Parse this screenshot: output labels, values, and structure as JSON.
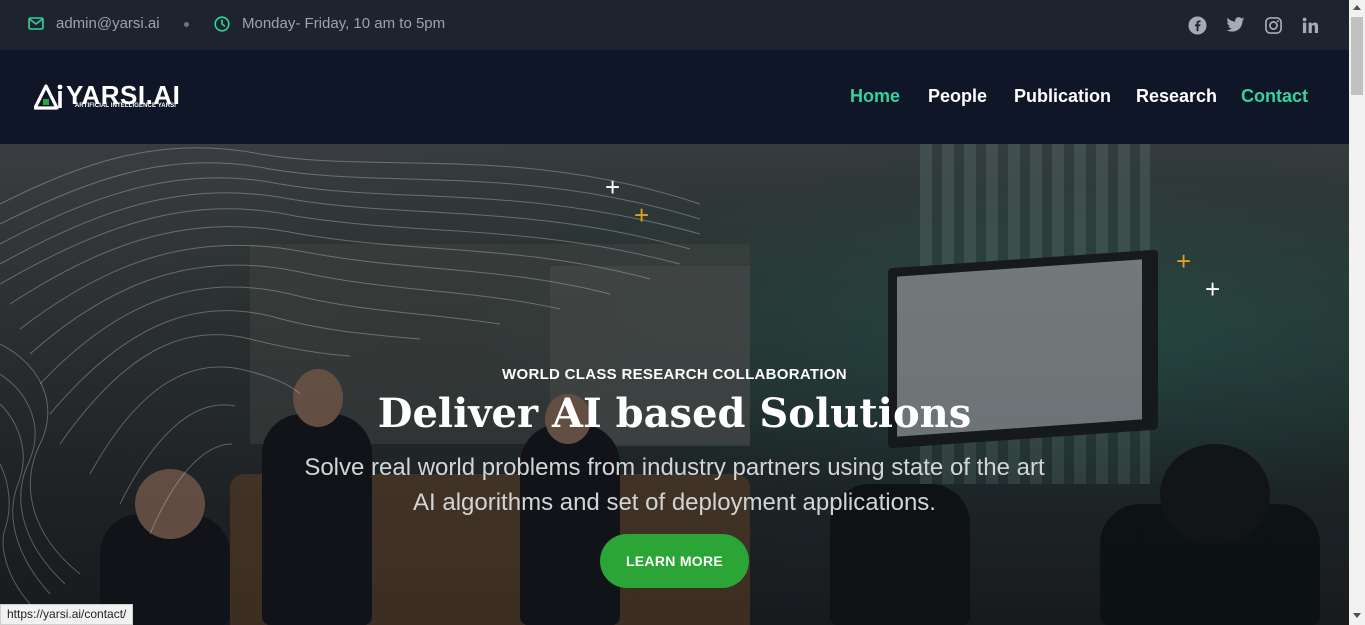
{
  "topbar": {
    "email": "admin@yarsi.ai",
    "hours": "Monday- Friday, 10 am to 5pm",
    "social": [
      "facebook-icon",
      "twitter-icon",
      "instagram-icon",
      "linkedin-icon"
    ]
  },
  "nav": {
    "logo_text": "YARSI.AI",
    "logo_sub": "ARTIFICIAL INTELLIGENCE YARSI",
    "items": [
      {
        "label": "Home",
        "active": true
      },
      {
        "label": "People",
        "active": false
      },
      {
        "label": "Publication",
        "active": false
      },
      {
        "label": "Research",
        "active": false
      },
      {
        "label": "Contact",
        "active": true
      }
    ]
  },
  "hero": {
    "kicker": "WORLD CLASS RESEARCH COLLABORATION",
    "title": "Deliver AI based Solutions",
    "description": "Solve real world problems from industry partners using state of the art AI algorithms and set of deployment applications.",
    "button": "LEARN MORE"
  },
  "status_bar": {
    "url": "https://yarsi.ai/contact/"
  },
  "colors": {
    "accent": "#34d39a",
    "button": "#2aa536",
    "nav_bg": "#0e1628",
    "topbar_bg": "#1e2330",
    "plus_orange": "#e0a020"
  }
}
